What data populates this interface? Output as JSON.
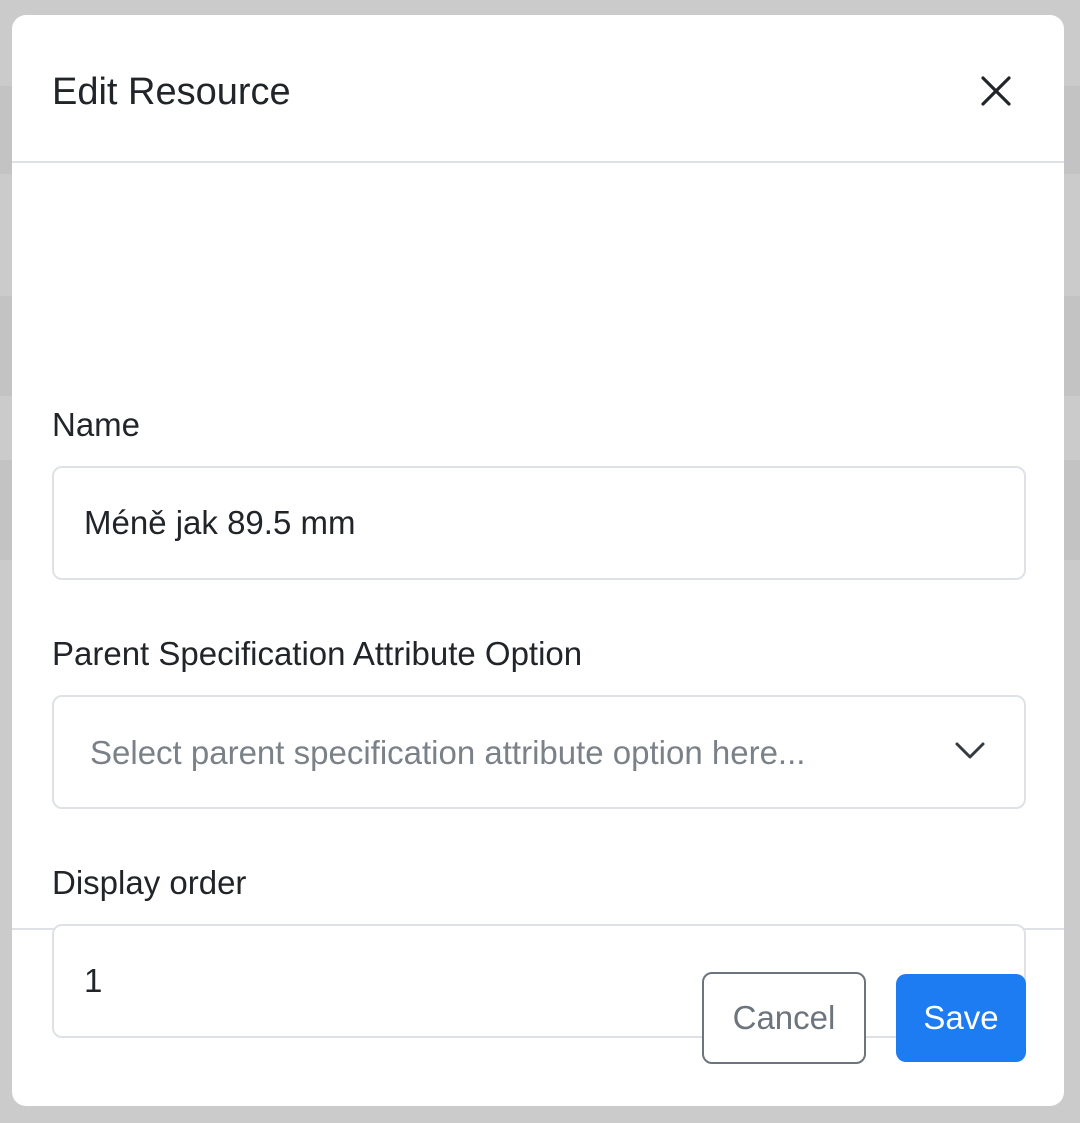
{
  "modal": {
    "title": "Edit Resource",
    "close_label": "×"
  },
  "form": {
    "name": {
      "label": "Name",
      "value": "Méně jak 89.5 mm"
    },
    "parent_option": {
      "label": "Parent Specification Attribute Option",
      "placeholder": "Select parent specification attribute option here..."
    },
    "display_order": {
      "label": "Display order",
      "value": "1"
    }
  },
  "footer": {
    "cancel_label": "Cancel",
    "save_label": "Save"
  },
  "colors": {
    "primary": "#1e7cf2",
    "border": "#dee2e6",
    "text": "#212529",
    "muted": "#6c757d"
  },
  "icons": {
    "close": "close-icon",
    "dropdown": "chevron-down-icon"
  }
}
